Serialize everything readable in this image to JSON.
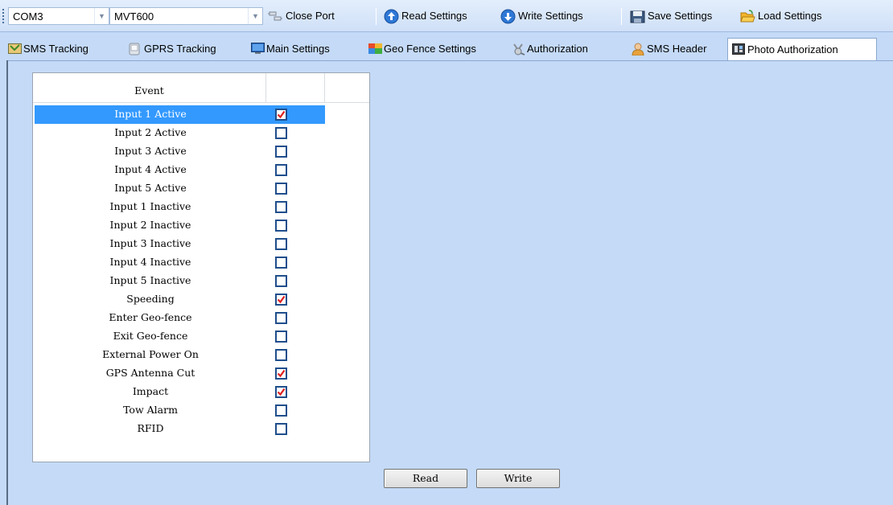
{
  "toolbar": {
    "port": "COM3",
    "device": "MVT600",
    "close_port": "Close Port",
    "read_settings": "Read Settings",
    "write_settings": "Write Settings",
    "save_settings": "Save Settings",
    "load_settings": "Load Settings"
  },
  "tabs": [
    {
      "label": "SMS Tracking",
      "icon": "sms-tracking-icon"
    },
    {
      "label": "GPRS Tracking",
      "icon": "gprs-tracking-icon"
    },
    {
      "label": "Main Settings",
      "icon": "main-settings-icon"
    },
    {
      "label": "Geo Fence Settings",
      "icon": "geo-fence-icon"
    },
    {
      "label": "Authorization",
      "icon": "authorization-icon"
    },
    {
      "label": "SMS Header",
      "icon": "sms-header-icon"
    },
    {
      "label": "Photo Authorization",
      "icon": "photo-authorization-icon",
      "active": true
    }
  ],
  "grid": {
    "header": "Event",
    "rows": [
      {
        "event": "Input 1 Active",
        "checked": true,
        "selected": true
      },
      {
        "event": "Input 2 Active",
        "checked": false
      },
      {
        "event": "Input 3 Active",
        "checked": false
      },
      {
        "event": "Input 4 Active",
        "checked": false
      },
      {
        "event": "Input 5 Active",
        "checked": false
      },
      {
        "event": "Input 1 Inactive",
        "checked": false
      },
      {
        "event": "Input 2 Inactive",
        "checked": false
      },
      {
        "event": "Input 3 Inactive",
        "checked": false
      },
      {
        "event": "Input 4 Inactive",
        "checked": false
      },
      {
        "event": "Input 5 Inactive",
        "checked": false
      },
      {
        "event": "Speeding",
        "checked": true
      },
      {
        "event": "Enter Geo-fence",
        "checked": false
      },
      {
        "event": "Exit Geo-fence",
        "checked": false
      },
      {
        "event": "External Power On",
        "checked": false
      },
      {
        "event": "GPS Antenna Cut",
        "checked": true
      },
      {
        "event": "Impact",
        "checked": true
      },
      {
        "event": "Tow Alarm",
        "checked": false
      },
      {
        "event": "RFID",
        "checked": false
      }
    ]
  },
  "buttons": {
    "read": "Read",
    "write": "Write"
  },
  "colors": {
    "background": "#c4daf7",
    "selection": "#3399ff",
    "check_mark": "#e02020",
    "checkbox_border": "#1f4e8c"
  }
}
